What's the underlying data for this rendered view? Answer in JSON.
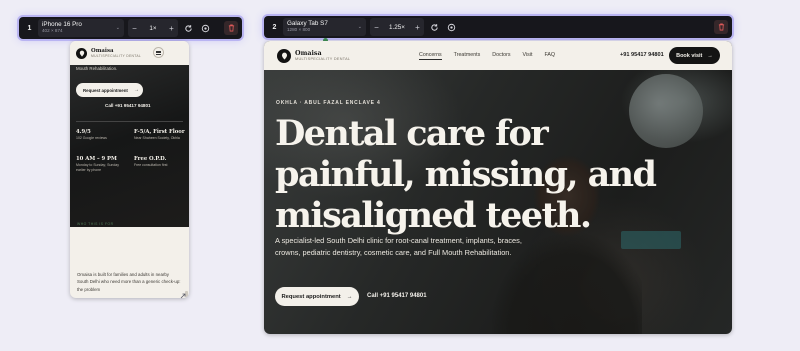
{
  "devices": [
    {
      "index": "1",
      "name": "iPhone 16 Pro",
      "size": "402 × 874",
      "zoom": "1×"
    },
    {
      "index": "2",
      "name": "Galaxy Tab S7",
      "size": "1280 × 800",
      "zoom": "1.25×"
    }
  ],
  "toolbar": {
    "minus": "−",
    "plus": "+",
    "chevron": "⌄"
  },
  "site": {
    "brand_name": "Omaisa",
    "brand_sub": "MULTISPECIALITY DENTAL",
    "nav": [
      "Concerns",
      "Treatments",
      "Doctors",
      "Visit",
      "FAQ"
    ],
    "phone": "+91 95417 94801",
    "book_label": "Book visit",
    "location": "OKHLA · ABUL FAZAL ENCLAVE 4",
    "headline": [
      "Dental care for",
      "painful, missing, and",
      "misaligned teeth."
    ],
    "subtext": "A specialist-led South Delhi clinic for root-canal treatment, implants, braces, crowns, pediatric dentistry, cosmetic care, and Full Mouth Rehabilitation.",
    "request_label": "Request appointment",
    "call_label": "Call +91 95417 94801",
    "arrow": "→"
  },
  "mobile": {
    "top_line": "Mouth Rehabilitation.",
    "stats": [
      {
        "title": "4.9/5",
        "sub": "102 Google reviews"
      },
      {
        "title": "F-5/A, First Floor",
        "sub": "Near Shaheen Society, Okhla"
      },
      {
        "title": "10 AM – 9 PM",
        "sub": "Monday to Sunday; Sunday earlier by phone"
      },
      {
        "title": "Free O.P.D.",
        "sub": "Free consultation first"
      }
    ],
    "who_label": "WHO THIS IS FOR",
    "body": "Omaisa is built for families and adults in nearby South Delhi who need more than a generic check-up: the problem"
  }
}
